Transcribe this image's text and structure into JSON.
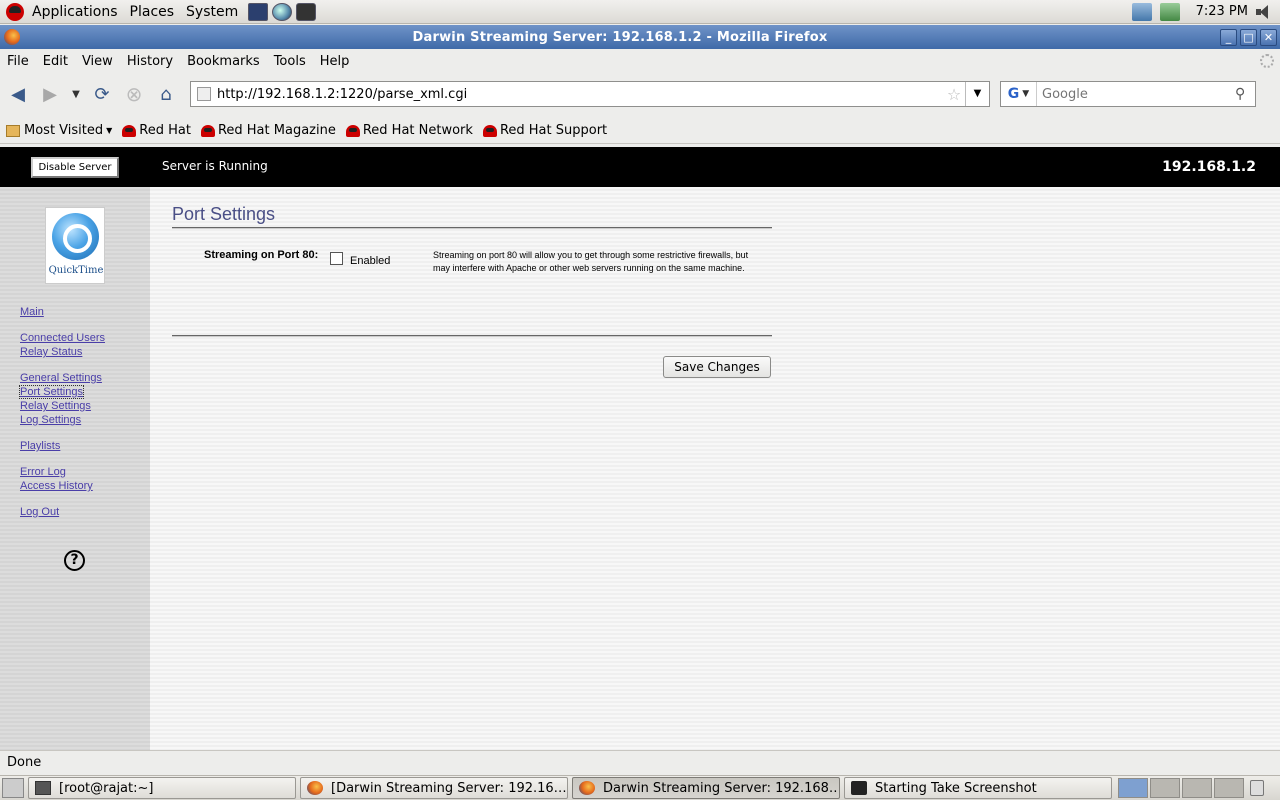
{
  "top_panel": {
    "menus": [
      "Applications",
      "Places",
      "System"
    ],
    "clock": "7:23 PM"
  },
  "window": {
    "title": "Darwin Streaming Server: 192.168.1.2 - Mozilla Firefox"
  },
  "menubar": {
    "items": [
      "File",
      "Edit",
      "View",
      "History",
      "Bookmarks",
      "Tools",
      "Help"
    ]
  },
  "navbar": {
    "url": "http://192.168.1.2:1220/parse_xml.cgi",
    "search_placeholder": "Google",
    "search_engine_letter": "G"
  },
  "bookmarks": {
    "most_visited": "Most Visited",
    "items": [
      "Red Hat",
      "Red Hat Magazine",
      "Red Hat Network",
      "Red Hat Support"
    ]
  },
  "page": {
    "header": {
      "disable_button": "Disable Server",
      "status": "Server is Running",
      "ip": "192.168.1.2"
    },
    "logo_text": "QuickTime",
    "sidebar_links": [
      "Main",
      "Connected Users",
      "Relay Status",
      "General Settings",
      "Port Settings",
      "Relay Settings",
      "Log Settings",
      "Playlists",
      "Error Log",
      "Access History",
      "Log Out"
    ],
    "current_link": "Port Settings",
    "help_symbol": "?",
    "title": "Port Settings",
    "port80": {
      "label": "Streaming on Port 80:",
      "checkbox_label": "Enabled",
      "checked": false,
      "description": "Streaming on port 80 will allow you to get through some restrictive firewalls, but may interfere with Apache or other web servers running on the same machine."
    },
    "save_button": "Save Changes"
  },
  "statusbar": {
    "text": "Done"
  },
  "taskbar": {
    "tasks": [
      "[root@rajat:~]",
      "[Darwin Streaming Server: 192.16…",
      "Darwin Streaming Server: 192.168…",
      "Starting Take Screenshot"
    ],
    "active_task": 2
  },
  "colors": {
    "title_bar": "#4f78b8",
    "page_header_bg": "#000000",
    "link_color": "#4a3ea8",
    "heading_color": "#4a4f86"
  }
}
